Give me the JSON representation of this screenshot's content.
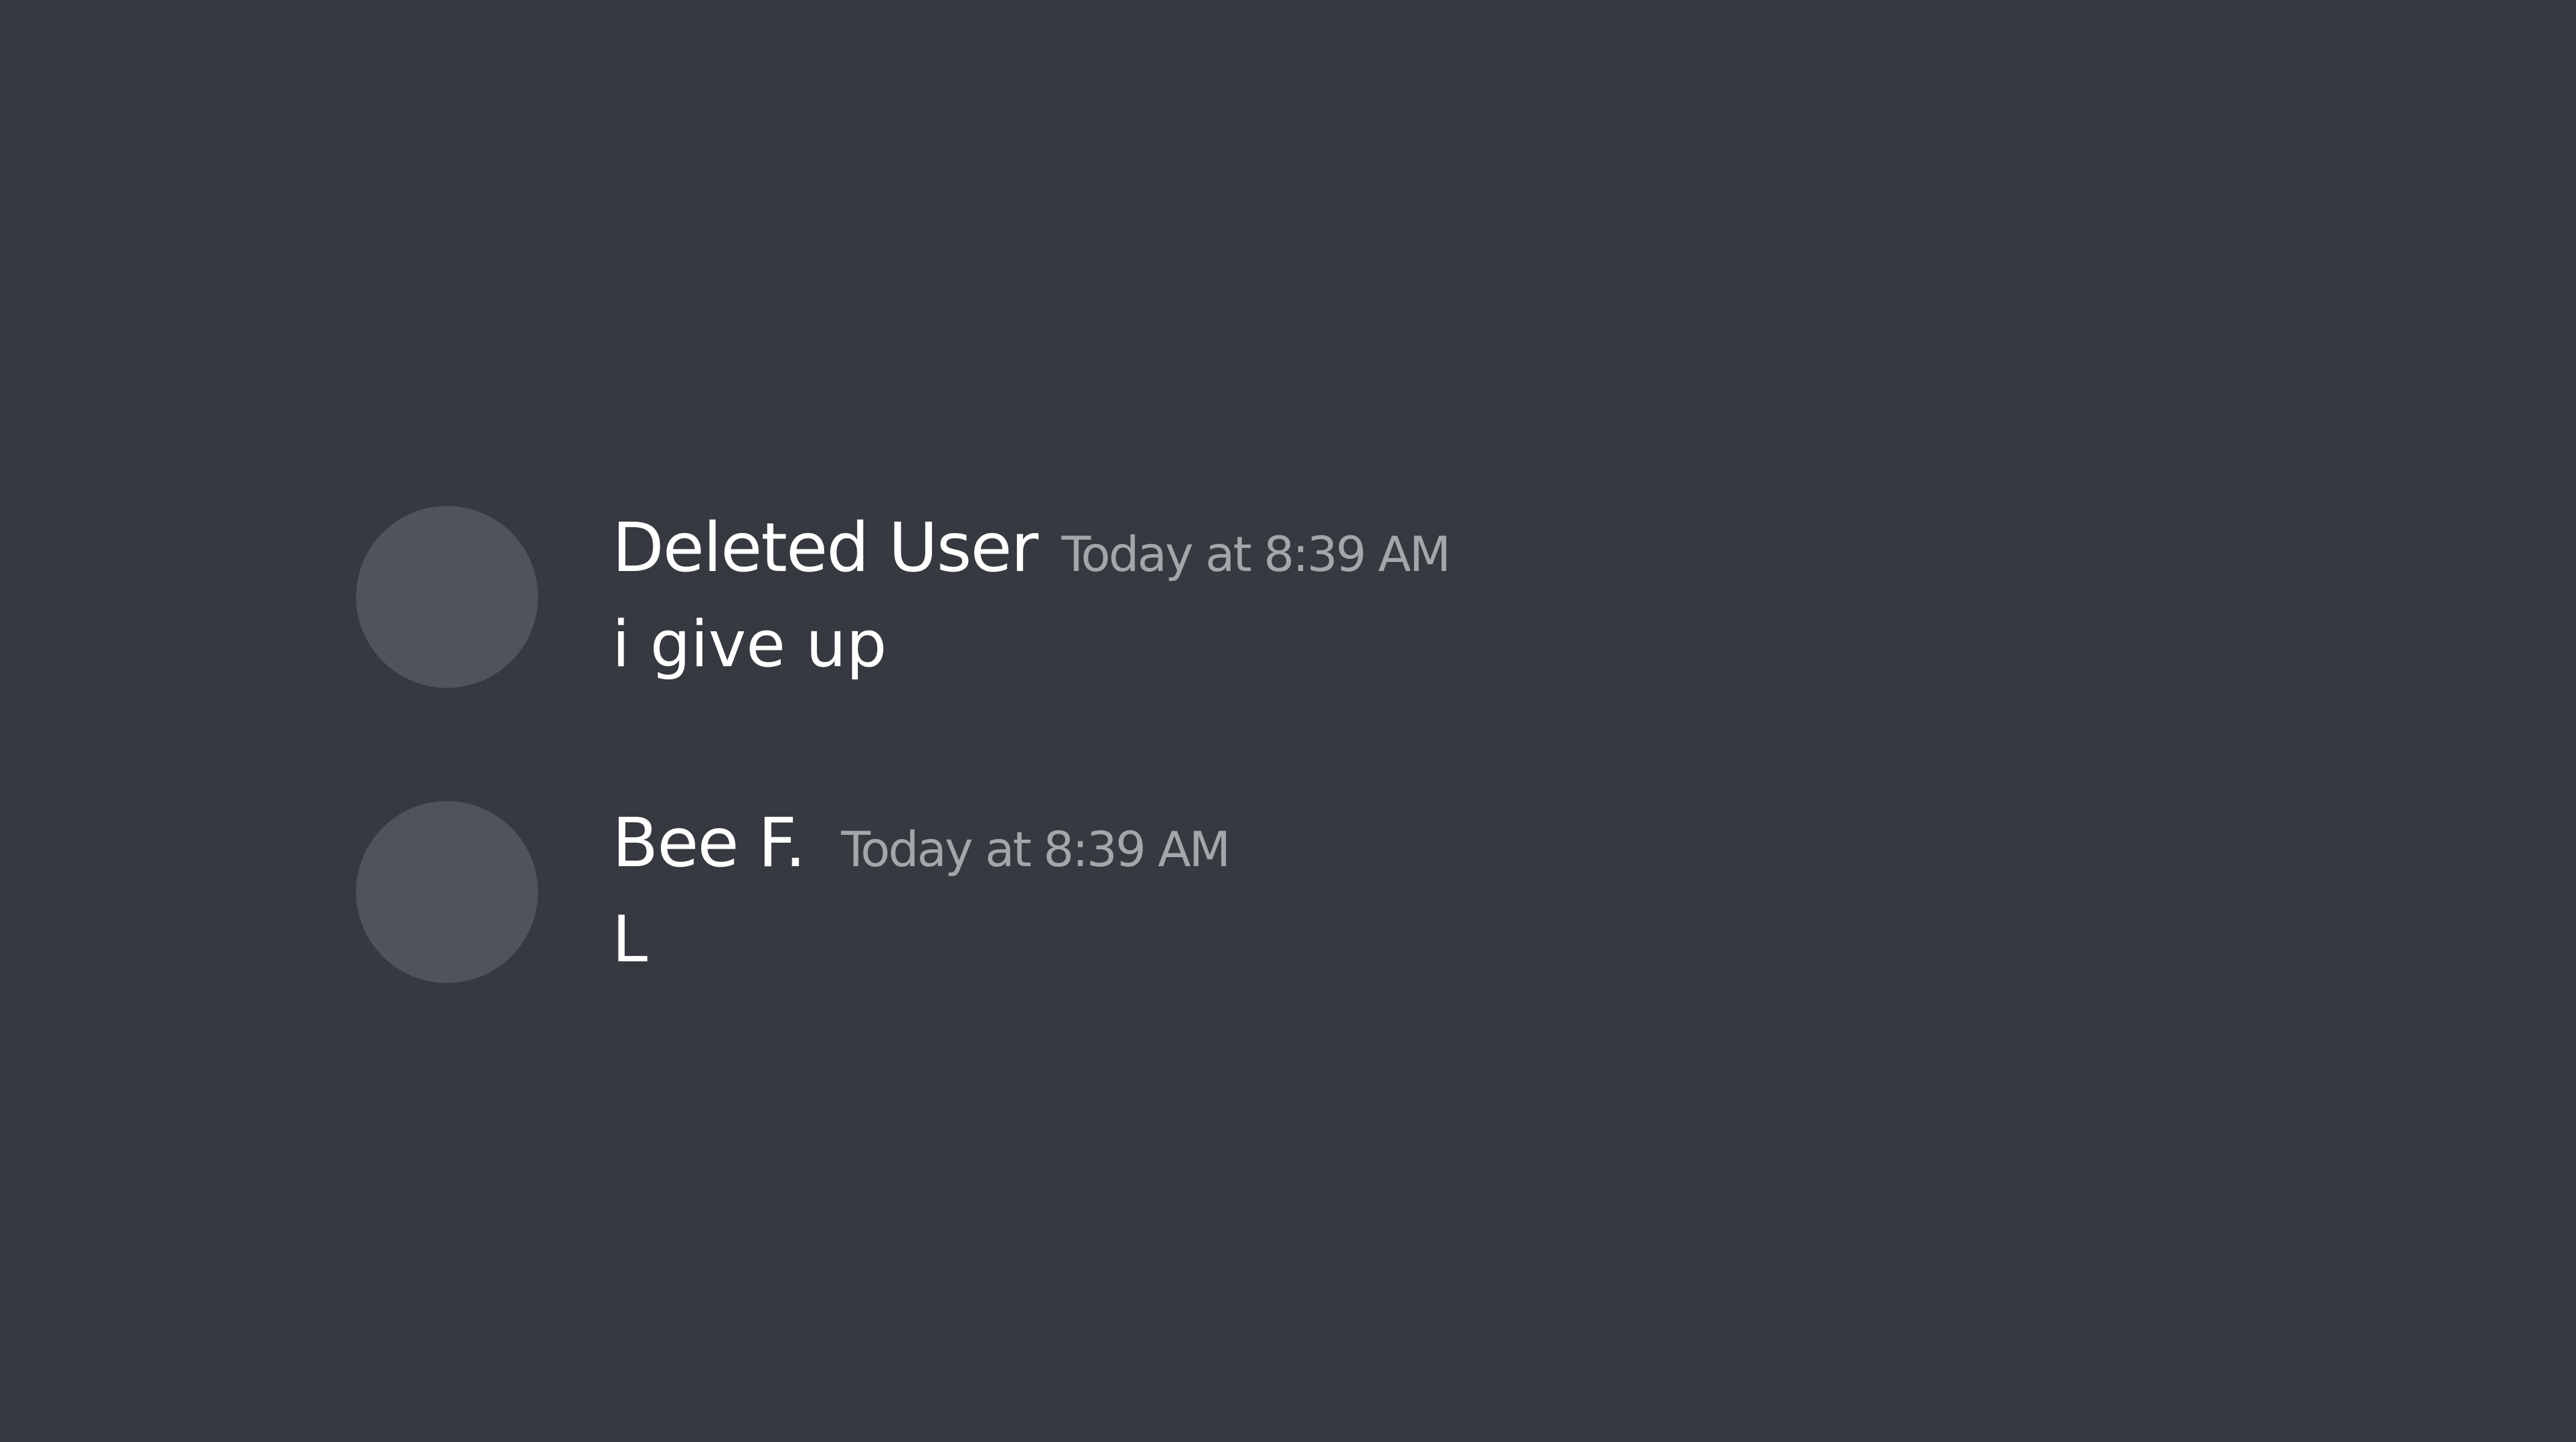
{
  "theme": {
    "background": "#36393f",
    "avatar_color": "#4f545c",
    "username_color": "#ffffff",
    "timestamp_color": "#a3a6aa",
    "text_color": "#ffffff"
  },
  "messages": [
    {
      "username": "Deleted User",
      "timestamp": "Today at 8:39 AM",
      "content": "i give up"
    },
    {
      "username": "Bee F.",
      "timestamp": "Today at 8:39 AM",
      "content": "L"
    }
  ]
}
